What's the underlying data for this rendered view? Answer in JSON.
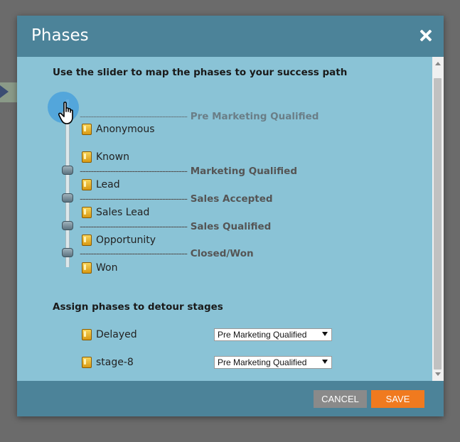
{
  "dialog": {
    "title": "Phases",
    "close_icon": "close-icon"
  },
  "slider_section": {
    "title": "Use the slider to map the phases to your success path",
    "dash": "---------------------------------------",
    "phases": [
      "Pre Marketing Qualified",
      "Marketing Qualified",
      "Sales Accepted",
      "Sales Qualified",
      "Closed/Won"
    ],
    "stages": [
      "Anonymous",
      "Known",
      "Lead",
      "Sales Lead",
      "Opportunity",
      "Won"
    ]
  },
  "detour_section": {
    "title": "Assign phases to detour stages",
    "rows": [
      {
        "stage": "Delayed",
        "selected": "Pre Marketing Qualified"
      },
      {
        "stage": "stage-8",
        "selected": "Pre Marketing Qualified"
      }
    ]
  },
  "footer": {
    "cancel_label": "CANCEL",
    "save_label": "SAVE"
  },
  "colors": {
    "header": "#4c8399",
    "content": "#8ac3d6",
    "save": "#f07a1f",
    "cancel": "#8a8a8a"
  }
}
